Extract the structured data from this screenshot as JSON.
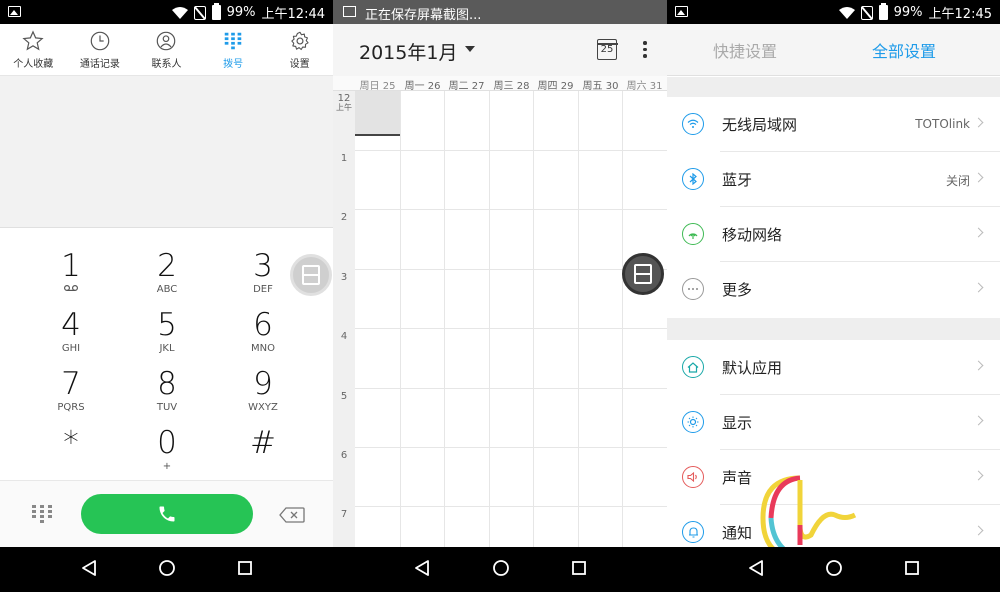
{
  "status_left": {
    "battery": "99%",
    "time": "上午12:44"
  },
  "status_right": {
    "battery": "99%",
    "time": "上午12:45"
  },
  "notification": {
    "text": "正在保存屏幕截图..."
  },
  "dialer": {
    "tabs": [
      {
        "label": "个人收藏",
        "icon": "star-icon"
      },
      {
        "label": "通话记录",
        "icon": "clock-icon"
      },
      {
        "label": "联系人",
        "icon": "person-icon"
      },
      {
        "label": "拨号",
        "icon": "dialpad-icon",
        "active": true
      },
      {
        "label": "设置",
        "icon": "gear-icon"
      }
    ],
    "keys": [
      {
        "digit": "1",
        "letters": ""
      },
      {
        "digit": "2",
        "letters": "ABC"
      },
      {
        "digit": "3",
        "letters": "DEF"
      },
      {
        "digit": "4",
        "letters": "GHI"
      },
      {
        "digit": "5",
        "letters": "JKL"
      },
      {
        "digit": "6",
        "letters": "MNO"
      },
      {
        "digit": "7",
        "letters": "PQRS"
      },
      {
        "digit": "8",
        "letters": "TUV"
      },
      {
        "digit": "9",
        "letters": "WXYZ"
      },
      {
        "digit": "*",
        "letters": ""
      },
      {
        "digit": "0",
        "letters": "+"
      },
      {
        "digit": "#",
        "letters": ""
      }
    ]
  },
  "calendar": {
    "month": "2015年1月",
    "today_badge": "25",
    "days": [
      "周日 25",
      "周一 26",
      "周二 27",
      "周三 28",
      "周四 29",
      "周五 30",
      "周六 31"
    ],
    "first_hour": "12",
    "first_hour_suffix": "上午",
    "hours": [
      "1",
      "2",
      "3",
      "4",
      "5",
      "6",
      "7"
    ]
  },
  "settings": {
    "tabs": {
      "quick": "快捷设置",
      "all": "全部设置"
    },
    "section1": [
      {
        "label": "无线局域网",
        "value": "TOTOlink",
        "icon": "wifi-icon",
        "color": "#1e9be9"
      },
      {
        "label": "蓝牙",
        "value": "关闭",
        "icon": "bluetooth-icon",
        "color": "#1e9be9"
      },
      {
        "label": "移动网络",
        "value": "",
        "icon": "signal-icon",
        "color": "#3fba54"
      },
      {
        "label": "更多",
        "value": "",
        "icon": "more-icon",
        "color": "#888888"
      }
    ],
    "section2": [
      {
        "label": "默认应用",
        "value": "",
        "icon": "home-icon",
        "color": "#19a8a8"
      },
      {
        "label": "显示",
        "value": "",
        "icon": "display-icon",
        "color": "#1e9be9"
      },
      {
        "label": "声音",
        "value": "",
        "icon": "sound-icon",
        "color": "#e45a5a"
      },
      {
        "label": "通知",
        "value": "",
        "icon": "bell-icon",
        "color": "#1e9be9"
      }
    ]
  },
  "colors": {
    "accent": "#1e9be9",
    "call_green": "#26c455"
  }
}
